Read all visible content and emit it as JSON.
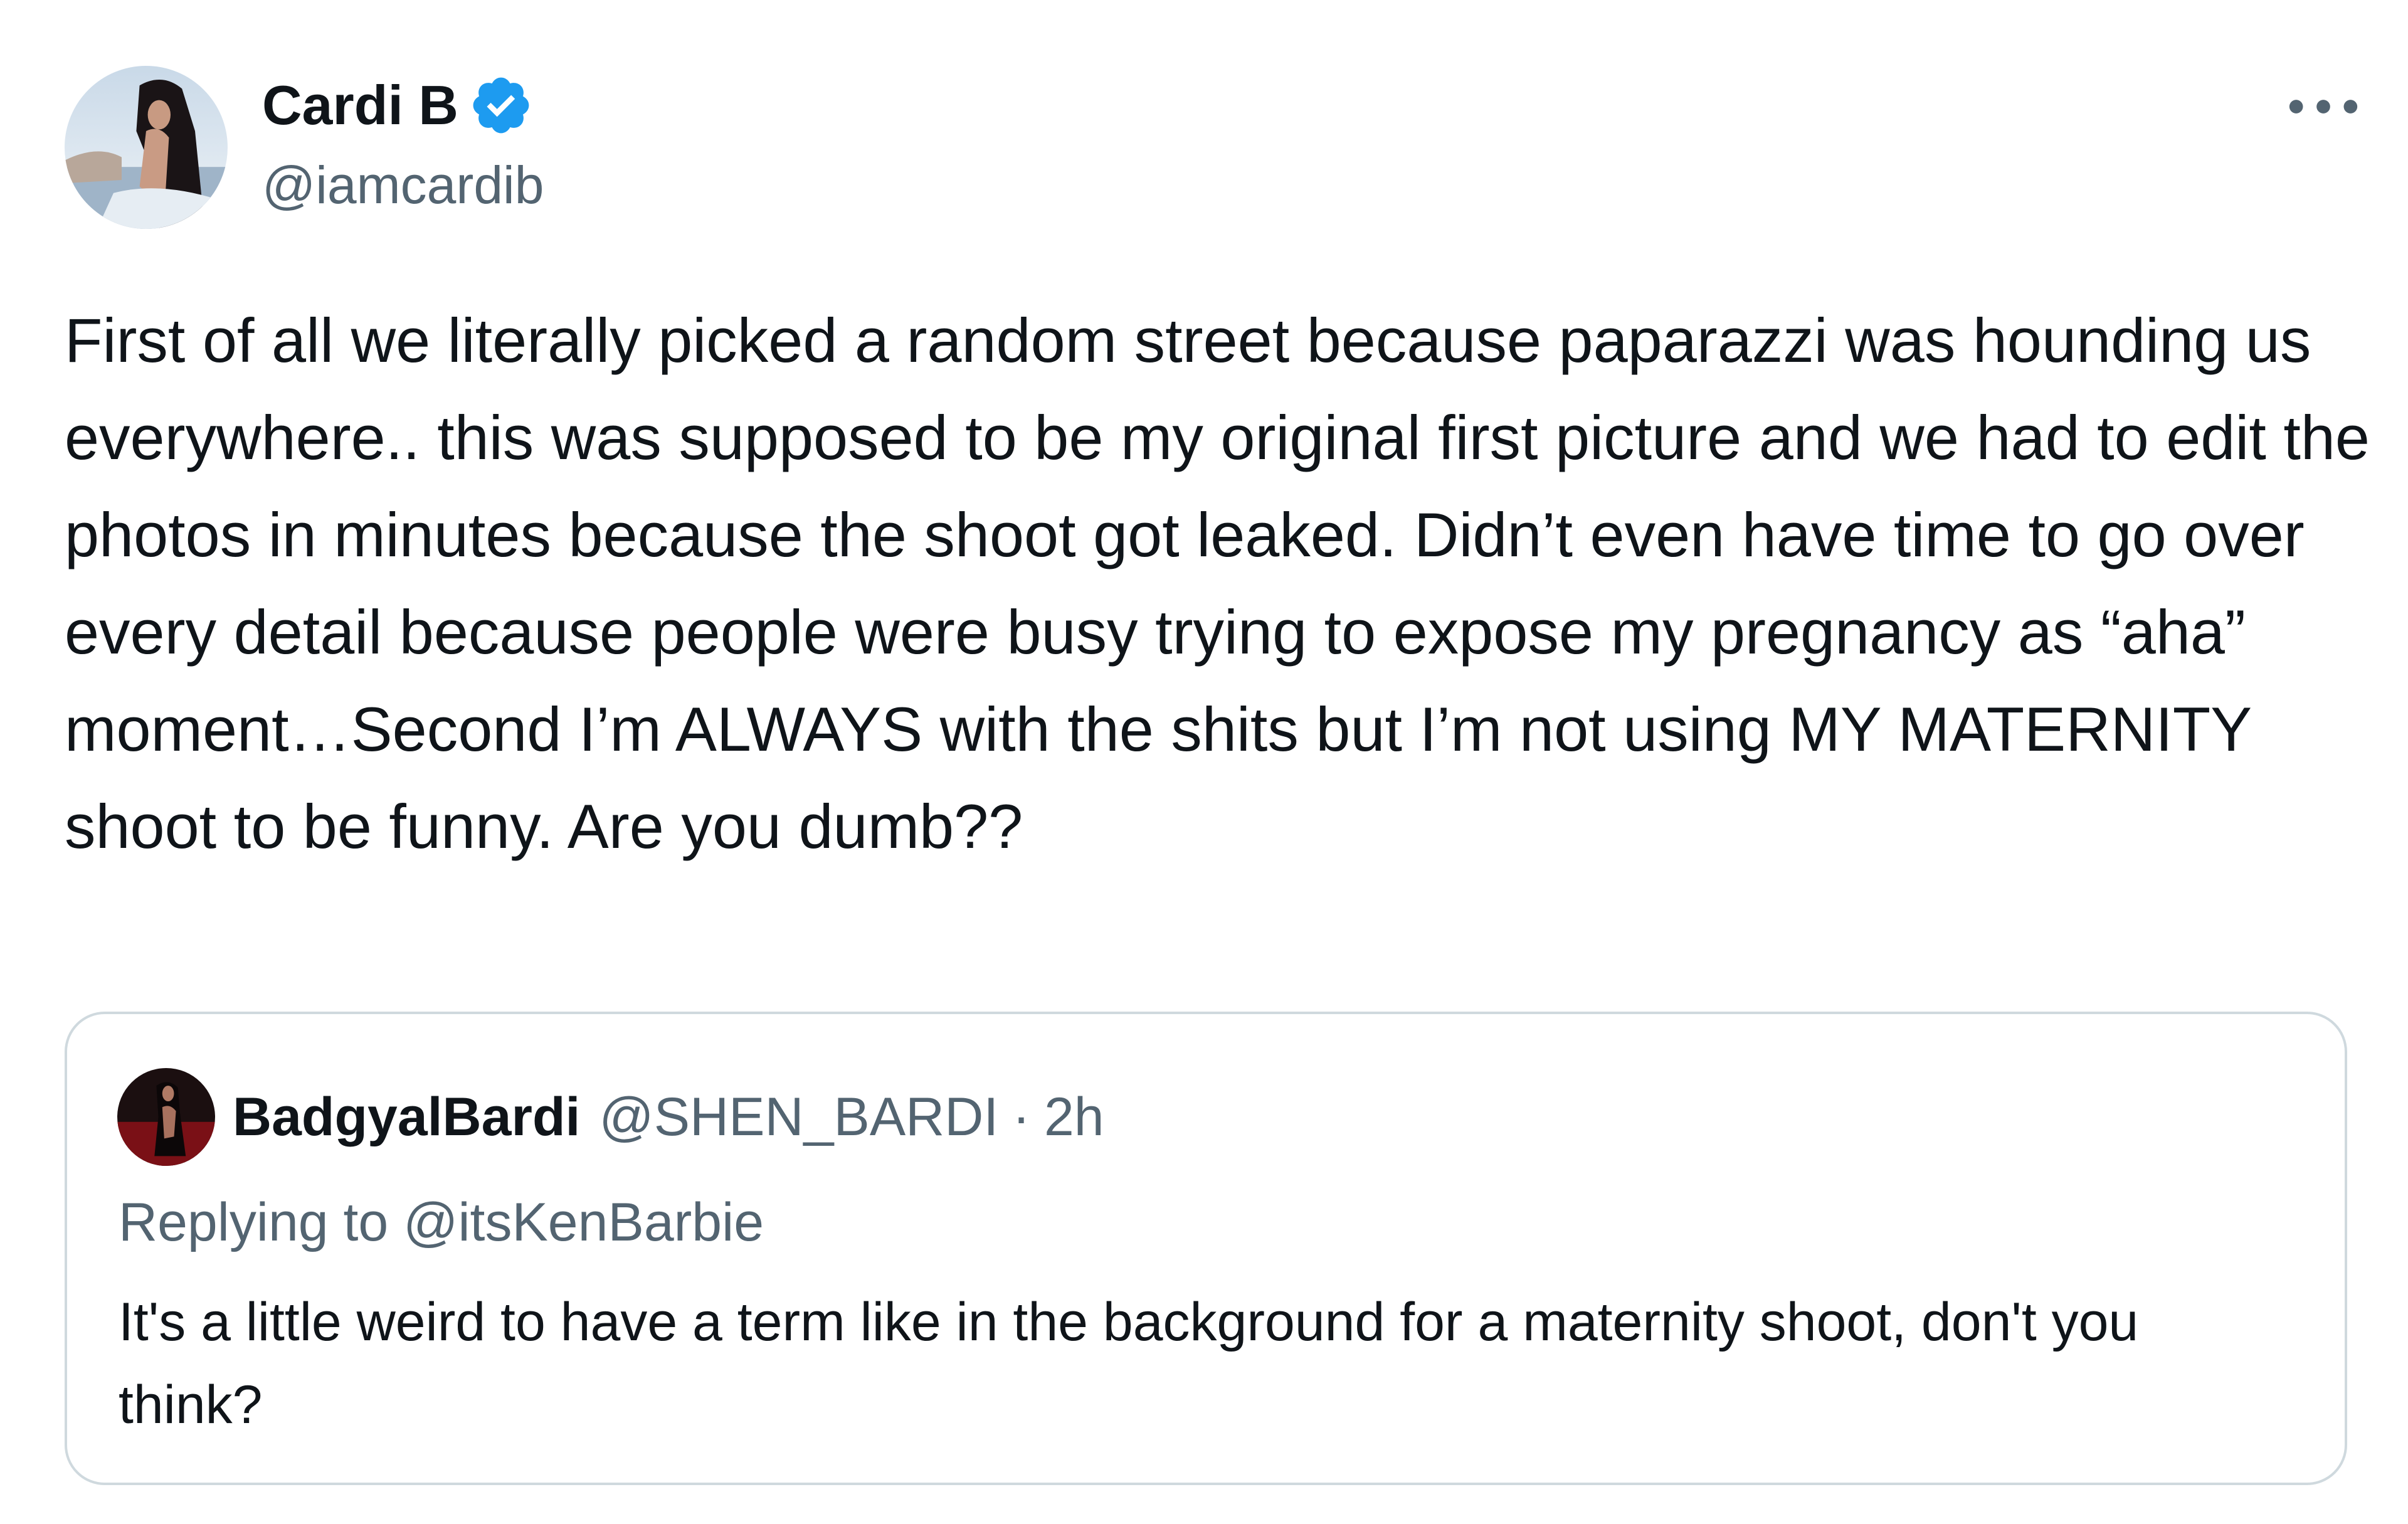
{
  "author": {
    "display_name": "Cardi B",
    "handle": "@iamcardib",
    "verified": true,
    "avatar_icon": "profile-photo"
  },
  "tweet": {
    "text": "First of all we literally picked a random street because paparazzi was hounding us everywhere.. this was supposed to be my original first picture and we had to edit the photos in minutes because the shoot got leaked. Didn’t even have time to go over every detail because people were busy trying to expose my pregnancy as “aha” moment…Second I’m ALWAYS with the shits but I’m not using MY MATERNITY shoot to be funny. Are you dumb??"
  },
  "quoted_tweet": {
    "display_name": "BadgyalBardi",
    "handle": "@SHEN_BARDI",
    "separator": "·",
    "time": "2h",
    "replying_to": "Replying to @itsKenBarbie",
    "text": "It's a little weird to have a term like in the background for a maternity shoot, don't you think?"
  },
  "colors": {
    "text_primary": "#0f1419",
    "text_secondary": "#536471",
    "verified_blue": "#1d9bf0",
    "border": "#cfd9de"
  },
  "icons": {
    "verified": "verified-badge-icon",
    "more": "more-options-icon"
  }
}
